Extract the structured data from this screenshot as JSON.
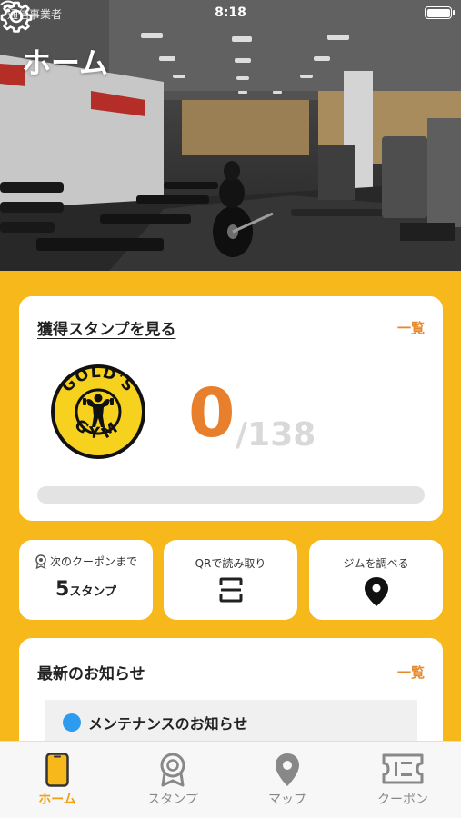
{
  "status_bar": {
    "carrier": "通信事業者",
    "time": "8:18"
  },
  "header": {
    "title": "ホーム",
    "settings_icon": "gear-icon"
  },
  "stamp_card": {
    "link_label": "獲得スタンプを見る",
    "see_all_label": "一覧",
    "logo_text_top": "GOLD'S",
    "logo_text_bottom": "GYM",
    "logo_icon": "golds-gym-logo",
    "count": "0",
    "total": "/138",
    "progress": 0
  },
  "tiles": [
    {
      "label": "次のクーポンまで",
      "value_number": "5",
      "value_unit": "スタンプ",
      "icon": "medal-icon"
    },
    {
      "label": "QRで読み取り",
      "icon": "qr-scan-icon"
    },
    {
      "label": "ジムを調べる",
      "icon": "map-pin-icon"
    }
  ],
  "news": {
    "title": "最新のお知らせ",
    "see_all_label": "一覧",
    "items": [
      {
        "text": "メンテナンスのお知らせ",
        "dot_color": "#2d9bf0"
      }
    ]
  },
  "tab_bar": {
    "tabs": [
      {
        "label": "ホーム",
        "icon": "phone-icon",
        "active": true
      },
      {
        "label": "スタンプ",
        "icon": "medal-icon",
        "active": false
      },
      {
        "label": "マップ",
        "icon": "map-pin-icon",
        "active": false
      },
      {
        "label": "クーポン",
        "icon": "ticket-icon",
        "active": false
      }
    ]
  },
  "colors": {
    "background": "#f7b81c",
    "accent_orange": "#e87f2c",
    "active_tab": "#f0a010",
    "news_dot": "#2d9bf0"
  }
}
